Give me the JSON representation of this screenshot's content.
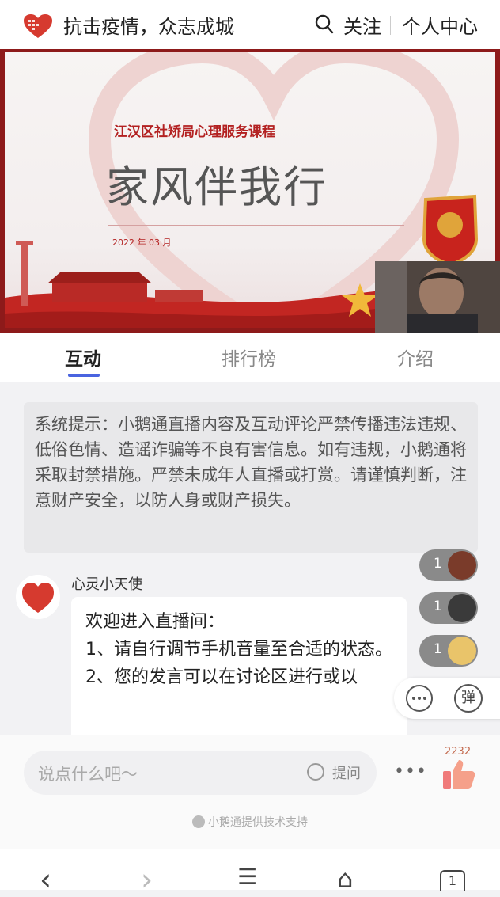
{
  "header": {
    "title": "抗击疫情，众志成城",
    "follow_label": "关注",
    "personal_label": "个人中心",
    "search_icon": "search-icon",
    "logo_icon": "heart-logo-icon"
  },
  "video": {
    "course_title": "江汉区社矫局心理服务课程",
    "main_title": "家风伴我行",
    "date": "2022 年 03 月",
    "camera_overlay": "camera-thumbnail"
  },
  "tabs": [
    {
      "label": "互动",
      "active": true
    },
    {
      "label": "排行榜",
      "active": false
    },
    {
      "label": "介绍",
      "active": false
    }
  ],
  "feed": {
    "system_notice": "系统提示：小鹅通直播内容及互动评论严禁传播违法违规、低俗色情、造谣诈骗等不良有害信息。如有违规，小鹅通将采取封禁措施。严禁未成年人直播或打赏。请谨慎判断，注意财产安全，以防人身或财产损失。",
    "message": {
      "username": "心灵小天使",
      "lines": [
        "欢迎进入直播间：",
        "1、请自行调节手机音量至合适的状态。",
        "2、您的发言可以在讨论区进行或以"
      ]
    },
    "gifts": [
      {
        "count": "1",
        "color": "#7a3b2a"
      },
      {
        "count": "1",
        "color": "#3a3a3a"
      },
      {
        "count": "1",
        "color": "#e9c46a"
      }
    ],
    "side_popup": {
      "danmu_label": "弹"
    }
  },
  "input_bar": {
    "placeholder": "说点什么吧～",
    "question_label": "提问",
    "more_label": "•••",
    "like_count": "2232",
    "support_text": "小鹅通提供技术支持"
  },
  "browser_nav": {
    "back": "‹",
    "forward": "›",
    "menu": "☰",
    "home": "⌂",
    "tabs_count": "1"
  },
  "colors": {
    "accent_red": "#b32121",
    "tab_indicator": "#4a64e0"
  }
}
